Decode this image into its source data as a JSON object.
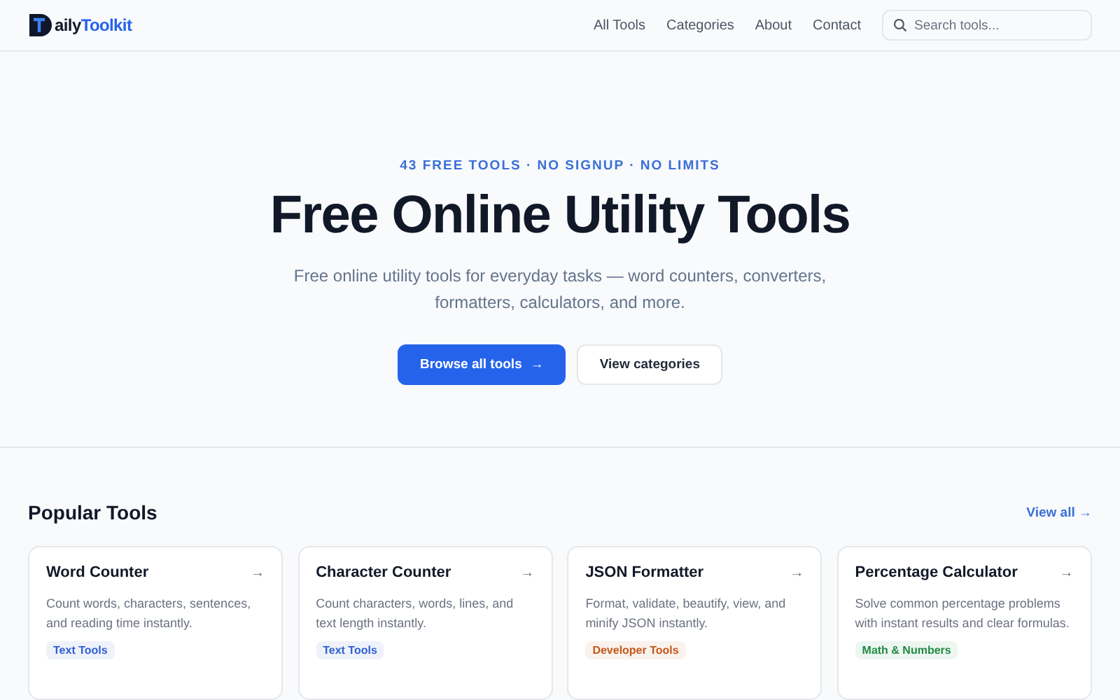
{
  "header": {
    "logo": {
      "prefix": "aily",
      "accent": "Toolkit"
    },
    "nav": [
      "All Tools",
      "Categories",
      "About",
      "Contact"
    ],
    "search": {
      "placeholder": "Search tools..."
    }
  },
  "hero": {
    "eyebrow": "43 FREE TOOLS · NO SIGNUP · NO LIMITS",
    "title": "Free Online Utility Tools",
    "subtitle": "Free online utility tools for everyday tasks — word counters, converters, formatters, calculators, and more.",
    "buttons": [
      {
        "label": "Browse all tools",
        "kind": "primary",
        "arrow": "→"
      },
      {
        "label": "View categories",
        "kind": "secondary"
      }
    ]
  },
  "popular": {
    "title": "Popular Tools",
    "view_all": "View all →",
    "cards": [
      {
        "title": "Word Counter",
        "arrow": "→",
        "description": "Count words, characters, sentences, and reading time instantly.",
        "tag": "Text Tools",
        "color": "#2f5fd0"
      },
      {
        "title": "Character Counter",
        "arrow": "→",
        "description": "Count characters, words, lines, and text length instantly.",
        "tag": "Text Tools",
        "color": "#2f5fd0"
      },
      {
        "title": "JSON Formatter",
        "arrow": "→",
        "description": "Format, validate, beautify, view, and minify JSON instantly.",
        "tag": "Developer Tools",
        "color": "#c2571a"
      },
      {
        "title": "Percentage Calculator",
        "arrow": "→",
        "description": "Solve common percentage problems with instant results and clear formulas.",
        "tag": "Math & Numbers",
        "color": "#1f8a43"
      }
    ]
  }
}
